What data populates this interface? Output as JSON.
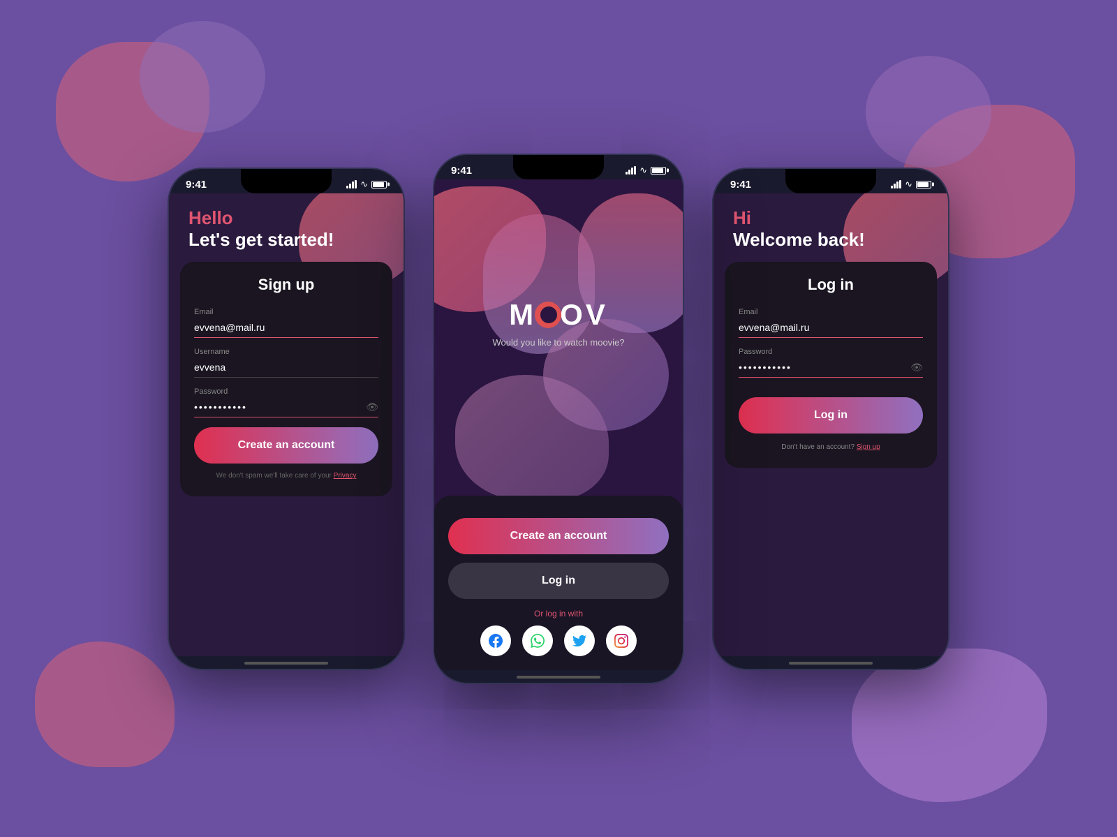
{
  "background": {
    "color": "#6b4fa0"
  },
  "phone1": {
    "status_time": "9:41",
    "hello": "Hello",
    "subtitle": "Let's get started!",
    "form_title": "Sign up",
    "email_label": "Email",
    "email_value": "evvena@mail.ru",
    "username_label": "Username",
    "username_value": "evvena",
    "password_label": "Password",
    "password_value": "••••••••••••",
    "cta_label": "Create an account",
    "privacy_text": "We don't spam we'll take care of your ",
    "privacy_link": "Privacy"
  },
  "phone2": {
    "status_time": "9:41",
    "logo": "MOOV",
    "subtitle": "Would you like to watch moovie?",
    "cta_label": "Create an account",
    "login_label": "Log in",
    "or_login_with": "Or log in with",
    "social_icons": [
      "facebook",
      "whatsapp",
      "twitter",
      "instagram"
    ]
  },
  "phone3": {
    "status_time": "9:41",
    "hi": "Hi",
    "subtitle": "Welcome back!",
    "form_title": "Log in",
    "email_label": "Email",
    "email_value": "evvena@mail.ru",
    "password_label": "Password",
    "password_value": "••••••••••••",
    "cta_label": "Log in",
    "no_account_text": "Don't have an account? ",
    "signup_link": "Sign up"
  }
}
